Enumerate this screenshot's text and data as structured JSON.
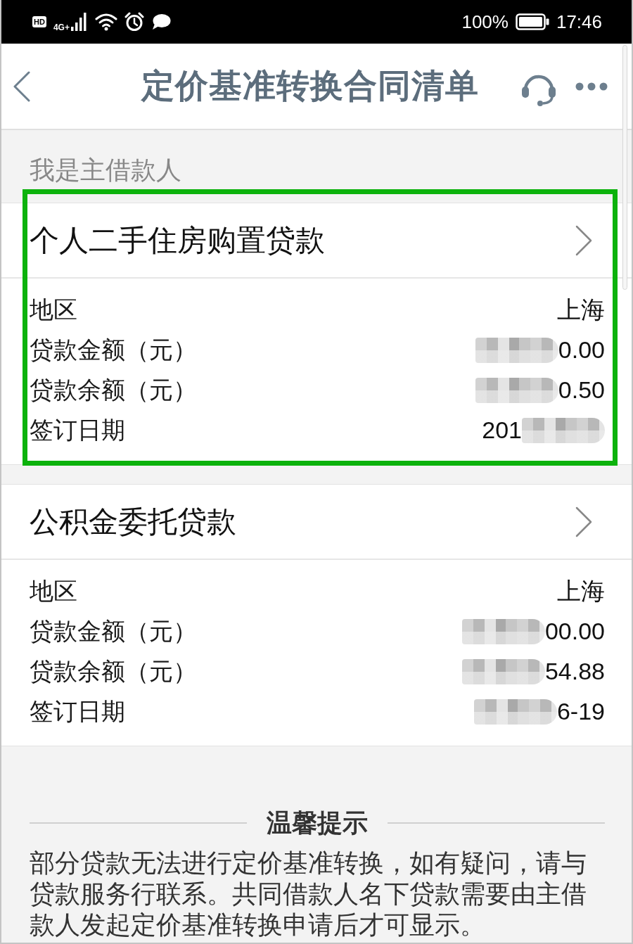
{
  "status_bar": {
    "hd_badge": "HD",
    "network": "4G+",
    "battery": "100%",
    "time": "17:46"
  },
  "header": {
    "title": "定价基准转换合同清单"
  },
  "section_label": "我是主借款人",
  "loans": [
    {
      "title": "个人二手住房购置贷款",
      "highlighted": true,
      "details": [
        {
          "label": "地区",
          "value": "上海",
          "masked_before": false,
          "masked_after": false
        },
        {
          "label": "贷款金额（元）",
          "value": "0.00",
          "masked_before": true,
          "masked_after": false
        },
        {
          "label": "贷款余额（元）",
          "value": "0.50",
          "masked_before": true,
          "masked_after": false
        },
        {
          "label": "签订日期",
          "value": "201",
          "masked_before": false,
          "masked_after": true
        }
      ]
    },
    {
      "title": "公积金委托贷款",
      "highlighted": false,
      "details": [
        {
          "label": "地区",
          "value": "上海",
          "masked_before": false,
          "masked_after": false
        },
        {
          "label": "贷款金额（元）",
          "value": "00.00",
          "masked_before": true,
          "masked_after": false
        },
        {
          "label": "贷款余额（元）",
          "value": "54.88",
          "masked_before": true,
          "masked_after": false
        },
        {
          "label": "签订日期",
          "value": "6-19",
          "masked_before": true,
          "masked_after": false
        }
      ]
    }
  ],
  "notice": {
    "title": "温馨提示",
    "text": "部分贷款无法进行定价基准转换，如有疑问，请与贷款服务行联系。共同借款人名下贷款需要由主借款人发起定价基准转换申请后才可显示。"
  }
}
